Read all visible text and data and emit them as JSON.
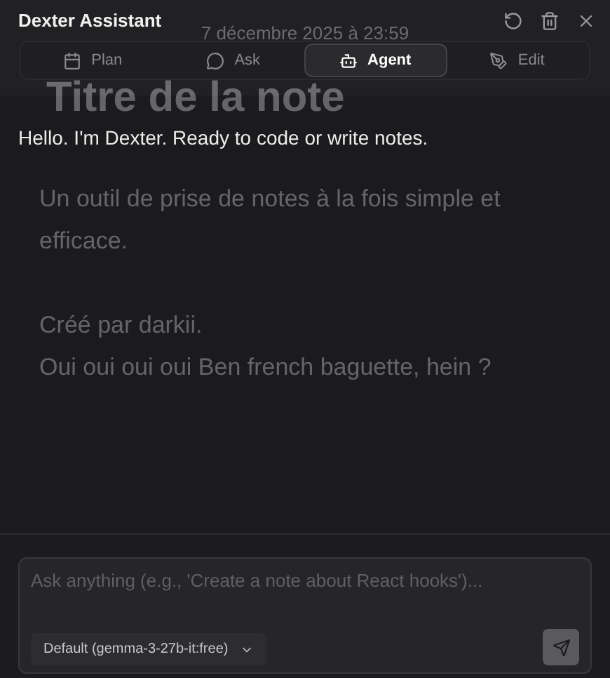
{
  "background_note": {
    "date": "7 décembre 2025 à 23:59",
    "title": "Titre de la note",
    "blocks": [
      [
        "Un outil de prise de notes à la fois simple et efficace."
      ],
      [
        "Créé par darkii.",
        "Oui oui oui oui Ben french baguette, hein ?"
      ]
    ]
  },
  "panel": {
    "title": "Dexter Assistant"
  },
  "tabs": [
    {
      "label": "Plan",
      "kind": "plan",
      "selected": false
    },
    {
      "label": "Ask",
      "kind": "ask",
      "selected": false
    },
    {
      "label": "Agent",
      "kind": "agent",
      "selected": true
    },
    {
      "label": "Edit",
      "kind": "edit",
      "selected": false
    }
  ],
  "messages": [
    {
      "text": "Hello. I'm Dexter. Ready to code or write notes."
    }
  ],
  "composer": {
    "placeholder": "Ask anything (e.g., 'Create a note about React hooks')...",
    "model": "Default (gemma-3-27b-it:free)"
  }
}
